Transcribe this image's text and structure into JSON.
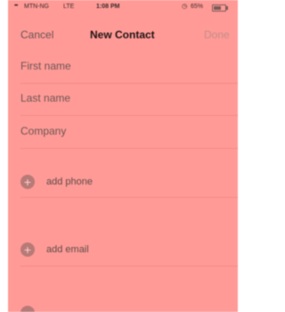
{
  "status_bar": {
    "signal": "•••",
    "carrier": "MTN-NG",
    "network": "LTE",
    "time": "1:08 PM",
    "alarm_icon": "alarm-icon",
    "battery_percent": "65%",
    "battery_level": 0.65
  },
  "nav": {
    "cancel_label": "Cancel",
    "title": "New Contact",
    "done_label": "Done"
  },
  "fields": {
    "first_name_placeholder": "First name",
    "last_name_placeholder": "Last name",
    "company_placeholder": "Company"
  },
  "add_rows": {
    "phone_label": "add phone",
    "email_label": "add email",
    "plus_glyph": "+"
  },
  "colors": {
    "overlay": "#ff9a96",
    "separator": "#f08a86"
  }
}
